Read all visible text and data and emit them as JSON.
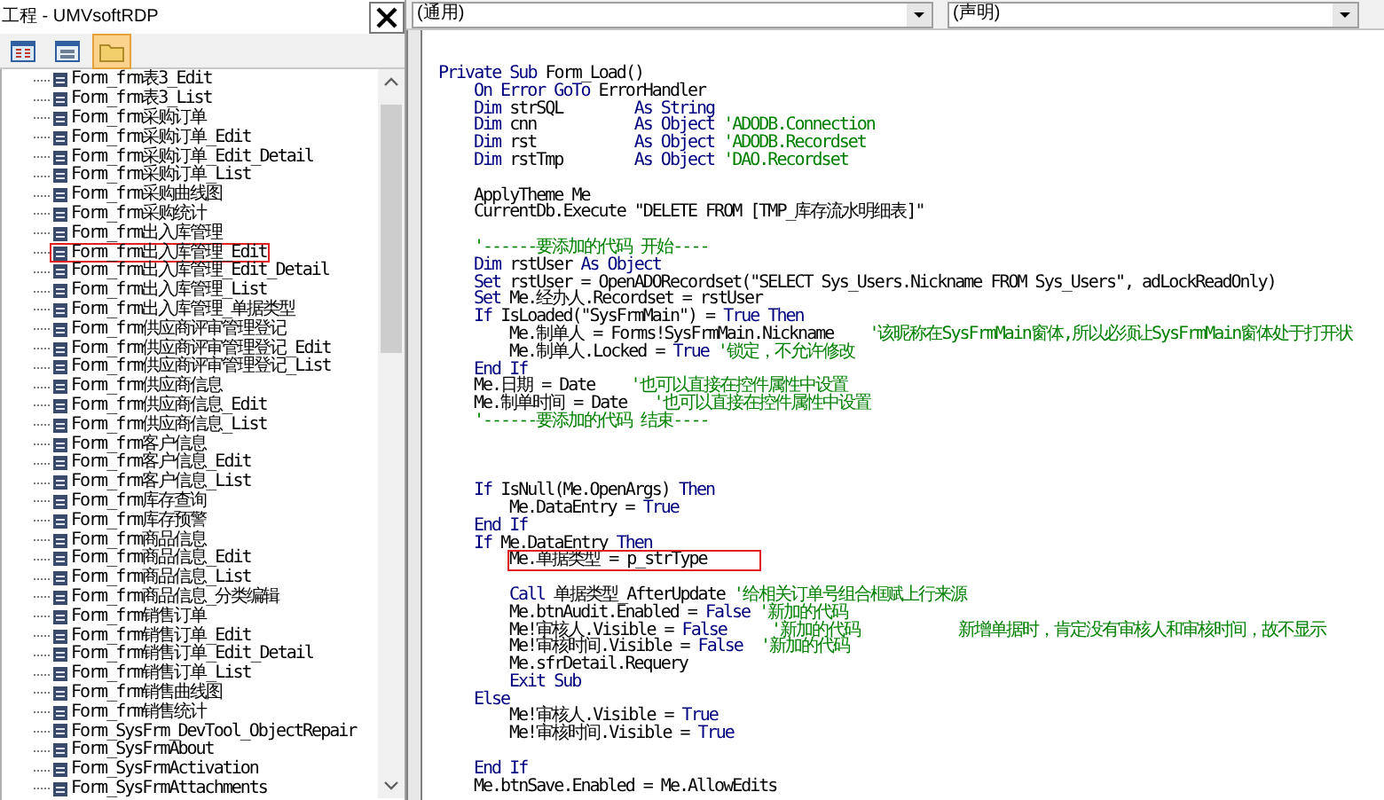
{
  "project_window": {
    "title": "工程 - UMVsoftRDP",
    "toolbar": [
      {
        "kind": "view-code",
        "selected": false
      },
      {
        "kind": "view-object",
        "selected": false
      },
      {
        "kind": "toggle-folders",
        "selected": true
      }
    ],
    "tree_items": [
      {
        "label": "Form_frm表3_Edit",
        "highlighted": false
      },
      {
        "label": "Form_frm表3_List",
        "highlighted": false
      },
      {
        "label": "Form_frm采购订单",
        "highlighted": false
      },
      {
        "label": "Form_frm采购订单_Edit",
        "highlighted": false
      },
      {
        "label": "Form_frm采购订单_Edit_Detail",
        "highlighted": false
      },
      {
        "label": "Form_frm采购订单_List",
        "highlighted": false
      },
      {
        "label": "Form_frm采购曲线图",
        "highlighted": false
      },
      {
        "label": "Form_frm采购统计",
        "highlighted": false
      },
      {
        "label": "Form_frm出入库管理",
        "highlighted": false
      },
      {
        "label": "Form_frm出入库管理_Edit",
        "highlighted": true
      },
      {
        "label": "Form_frm出入库管理_Edit_Detail",
        "highlighted": false
      },
      {
        "label": "Form_frm出入库管理_List",
        "highlighted": false
      },
      {
        "label": "Form_frm出入库管理_单据类型",
        "highlighted": false
      },
      {
        "label": "Form_frm供应商评审管理登记",
        "highlighted": false
      },
      {
        "label": "Form_frm供应商评审管理登记_Edit",
        "highlighted": false
      },
      {
        "label": "Form_frm供应商评审管理登记_List",
        "highlighted": false
      },
      {
        "label": "Form_frm供应商信息",
        "highlighted": false
      },
      {
        "label": "Form_frm供应商信息_Edit",
        "highlighted": false
      },
      {
        "label": "Form_frm供应商信息_List",
        "highlighted": false
      },
      {
        "label": "Form_frm客户信息",
        "highlighted": false
      },
      {
        "label": "Form_frm客户信息_Edit",
        "highlighted": false
      },
      {
        "label": "Form_frm客户信息_List",
        "highlighted": false
      },
      {
        "label": "Form_frm库存查询",
        "highlighted": false
      },
      {
        "label": "Form_frm库存预警",
        "highlighted": false
      },
      {
        "label": "Form_frm商品信息",
        "highlighted": false
      },
      {
        "label": "Form_frm商品信息_Edit",
        "highlighted": false
      },
      {
        "label": "Form_frm商品信息_List",
        "highlighted": false
      },
      {
        "label": "Form_frm商品信息_分类编辑",
        "highlighted": false
      },
      {
        "label": "Form_frm销售订单",
        "highlighted": false
      },
      {
        "label": "Form_frm销售订单_Edit",
        "highlighted": false
      },
      {
        "label": "Form_frm销售订单_Edit_Detail",
        "highlighted": false
      },
      {
        "label": "Form_frm销售订单_List",
        "highlighted": false
      },
      {
        "label": "Form_frm销售曲线图",
        "highlighted": false
      },
      {
        "label": "Form_frm销售统计",
        "highlighted": false
      },
      {
        "label": "Form_SysFrm_DevTool_ObjectRepair",
        "highlighted": false
      },
      {
        "label": "Form_SysFrmAbout",
        "highlighted": false
      },
      {
        "label": "Form_SysFrmActivation",
        "highlighted": false
      },
      {
        "label": "Form_SysFrmAttachments",
        "highlighted": false
      }
    ]
  },
  "code_window": {
    "object_dropdown": "(通用)",
    "procedure_dropdown": "(声明)",
    "lines": [
      {
        "kind": "code",
        "highlighted": false,
        "segments": [
          {
            "kind": "keyword",
            "text": "Private Sub"
          },
          {
            "kind": "plain",
            "text": " Form_Load()"
          }
        ],
        "children": [
          {
            "kind": "code",
            "highlighted": false,
            "segments": [
              {
                "kind": "keyword",
                "text": "On Error GoTo"
              },
              {
                "kind": "plain",
                "text": " ErrorHandler"
              }
            ]
          },
          {
            "kind": "code",
            "highlighted": false,
            "segments": [
              {
                "kind": "keyword",
                "text": "Dim"
              },
              {
                "kind": "plain",
                "text": " strSQL        "
              },
              {
                "kind": "keyword",
                "text": "As String"
              }
            ]
          },
          {
            "kind": "code",
            "highlighted": false,
            "segments": [
              {
                "kind": "keyword",
                "text": "Dim"
              },
              {
                "kind": "plain",
                "text": " cnn           "
              },
              {
                "kind": "keyword",
                "text": "As Object"
              },
              {
                "kind": "comment",
                "text": " 'ADODB.Connection"
              }
            ]
          },
          {
            "kind": "code",
            "highlighted": false,
            "segments": [
              {
                "kind": "keyword",
                "text": "Dim"
              },
              {
                "kind": "plain",
                "text": " rst           "
              },
              {
                "kind": "keyword",
                "text": "As Object"
              },
              {
                "kind": "comment",
                "text": " 'ADODB.Recordset"
              }
            ]
          },
          {
            "kind": "code",
            "highlighted": false,
            "segments": [
              {
                "kind": "keyword",
                "text": "Dim"
              },
              {
                "kind": "plain",
                "text": " rstTmp        "
              },
              {
                "kind": "keyword",
                "text": "As Object"
              },
              {
                "kind": "comment",
                "text": " 'DAO.Recordset"
              }
            ]
          },
          {
            "kind": "blank"
          },
          {
            "kind": "code",
            "highlighted": false,
            "segments": [
              {
                "kind": "plain",
                "text": "ApplyTheme Me"
              }
            ]
          },
          {
            "kind": "code",
            "highlighted": false,
            "segments": [
              {
                "kind": "plain",
                "text": "CurrentDb.Execute \"DELETE FROM [TMP_库存流水明细表]\""
              }
            ]
          },
          {
            "kind": "blank"
          },
          {
            "kind": "code",
            "highlighted": false,
            "segments": [
              {
                "kind": "comment",
                "text": "'------要添加的代码 开始----"
              }
            ]
          },
          {
            "kind": "code",
            "highlighted": false,
            "segments": [
              {
                "kind": "keyword",
                "text": "Dim"
              },
              {
                "kind": "plain",
                "text": " rstUser "
              },
              {
                "kind": "keyword",
                "text": "As Object"
              }
            ]
          },
          {
            "kind": "code",
            "highlighted": false,
            "segments": [
              {
                "kind": "keyword",
                "text": "Set"
              },
              {
                "kind": "plain",
                "text": " rstUser = OpenADORecordset(\"SELECT Sys_Users.Nickname FROM Sys_Users\", adLockReadOnly)"
              }
            ]
          },
          {
            "kind": "code",
            "highlighted": false,
            "segments": [
              {
                "kind": "keyword",
                "text": "Set"
              },
              {
                "kind": "plain",
                "text": " Me.经办人.Recordset = rstUser"
              }
            ]
          },
          {
            "kind": "code",
            "highlighted": false,
            "segments": [
              {
                "kind": "keyword",
                "text": "If"
              },
              {
                "kind": "plain",
                "text": " IsLoaded(\"SysFrmMain\") = "
              },
              {
                "kind": "keyword",
                "text": "True Then"
              }
            ],
            "children": [
              {
                "kind": "code",
                "highlighted": false,
                "segments": [
                  {
                    "kind": "plain",
                    "text": "Me.制单人 = Forms!SysFrmMain.Nickname"
                  },
                  {
                    "kind": "comment",
                    "text": "    '该昵称在SysFrmMain窗体,所以必须让SysFrmMain窗体处于打开状"
                  }
                ]
              },
              {
                "kind": "code",
                "highlighted": false,
                "segments": [
                  {
                    "kind": "plain",
                    "text": "Me.制单人.Locked = "
                  },
                  {
                    "kind": "keyword",
                    "text": "True"
                  },
                  {
                    "kind": "comment",
                    "text": " '锁定，不允许修改"
                  }
                ]
              }
            ]
          },
          {
            "kind": "code",
            "highlighted": false,
            "segments": [
              {
                "kind": "keyword",
                "text": "End If"
              }
            ]
          },
          {
            "kind": "code",
            "highlighted": false,
            "segments": [
              {
                "kind": "plain",
                "text": "Me.日期 = Date"
              },
              {
                "kind": "comment",
                "text": "    '也可以直接在控件属性中设置"
              }
            ]
          },
          {
            "kind": "code",
            "highlighted": false,
            "segments": [
              {
                "kind": "plain",
                "text": "Me.制单时间 = Date"
              },
              {
                "kind": "comment",
                "text": "   '也可以直接在控件属性中设置"
              }
            ]
          },
          {
            "kind": "code",
            "highlighted": false,
            "segments": [
              {
                "kind": "comment",
                "text": "'------要添加的代码 结束----"
              }
            ]
          },
          {
            "kind": "blank"
          },
          {
            "kind": "blank"
          },
          {
            "kind": "blank"
          },
          {
            "kind": "code",
            "highlighted": false,
            "segments": [
              {
                "kind": "keyword",
                "text": "If"
              },
              {
                "kind": "plain",
                "text": " IsNull(Me.OpenArgs) "
              },
              {
                "kind": "keyword",
                "text": "Then"
              }
            ],
            "children": [
              {
                "kind": "code",
                "highlighted": false,
                "segments": [
                  {
                    "kind": "plain",
                    "text": "Me.DataEntry = "
                  },
                  {
                    "kind": "keyword",
                    "text": "True"
                  }
                ]
              }
            ]
          },
          {
            "kind": "code",
            "highlighted": false,
            "segments": [
              {
                "kind": "keyword",
                "text": "End If"
              }
            ]
          },
          {
            "kind": "code",
            "highlighted": false,
            "segments": [
              {
                "kind": "keyword",
                "text": "If"
              },
              {
                "kind": "plain",
                "text": " Me.DataEntry "
              },
              {
                "kind": "keyword",
                "text": "Then"
              }
            ],
            "children": [
              {
                "kind": "code",
                "highlighted": true,
                "segments": [
                  {
                    "kind": "plain",
                    "text": "Me.单据类型 = p_strType"
                  }
                ]
              },
              {
                "kind": "blank"
              },
              {
                "kind": "code",
                "highlighted": false,
                "segments": [
                  {
                    "kind": "keyword",
                    "text": "Call"
                  },
                  {
                    "kind": "plain",
                    "text": " 单据类型_AfterUpdate "
                  },
                  {
                    "kind": "comment",
                    "text": "'给相关订单号组合框赋上行来源"
                  }
                ]
              },
              {
                "kind": "code",
                "highlighted": false,
                "segments": [
                  {
                    "kind": "plain",
                    "text": "Me.btnAudit.Enabled = "
                  },
                  {
                    "kind": "keyword",
                    "text": "False"
                  },
                  {
                    "kind": "comment",
                    "text": " '新加的代码"
                  }
                ]
              },
              {
                "kind": "code",
                "highlighted": false,
                "segments": [
                  {
                    "kind": "plain",
                    "text": "Me!审核人.Visible = "
                  },
                  {
                    "kind": "keyword",
                    "text": "False"
                  },
                  {
                    "kind": "comment",
                    "text": "     '新加的代码           新增单据时，肯定没有审核人和审核时间，故不显示"
                  }
                ]
              },
              {
                "kind": "code",
                "highlighted": false,
                "segments": [
                  {
                    "kind": "plain",
                    "text": "Me!审核时间.Visible = "
                  },
                  {
                    "kind": "keyword",
                    "text": "False"
                  },
                  {
                    "kind": "comment",
                    "text": "  '新加的代码"
                  }
                ]
              },
              {
                "kind": "code",
                "highlighted": false,
                "segments": [
                  {
                    "kind": "plain",
                    "text": "Me.sfrDetail.Requery"
                  }
                ]
              },
              {
                "kind": "code",
                "highlighted": false,
                "segments": [
                  {
                    "kind": "keyword",
                    "text": "Exit Sub"
                  }
                ]
              }
            ]
          },
          {
            "kind": "code",
            "highlighted": false,
            "segments": [
              {
                "kind": "keyword",
                "text": "Else"
              }
            ],
            "children": [
              {
                "kind": "code",
                "highlighted": false,
                "segments": [
                  {
                    "kind": "plain",
                    "text": "Me!审核人.Visible = "
                  },
                  {
                    "kind": "keyword",
                    "text": "True"
                  }
                ]
              },
              {
                "kind": "code",
                "highlighted": false,
                "segments": [
                  {
                    "kind": "plain",
                    "text": "Me!审核时间.Visible = "
                  },
                  {
                    "kind": "keyword",
                    "text": "True"
                  }
                ]
              }
            ]
          },
          {
            "kind": "blank"
          },
          {
            "kind": "code",
            "highlighted": false,
            "segments": [
              {
                "kind": "keyword",
                "text": "End If"
              }
            ]
          },
          {
            "kind": "code",
            "highlighted": false,
            "segments": [
              {
                "kind": "plain",
                "text": "Me.btnSave.Enabled = Me.AllowEdits"
              }
            ]
          }
        ]
      }
    ]
  }
}
